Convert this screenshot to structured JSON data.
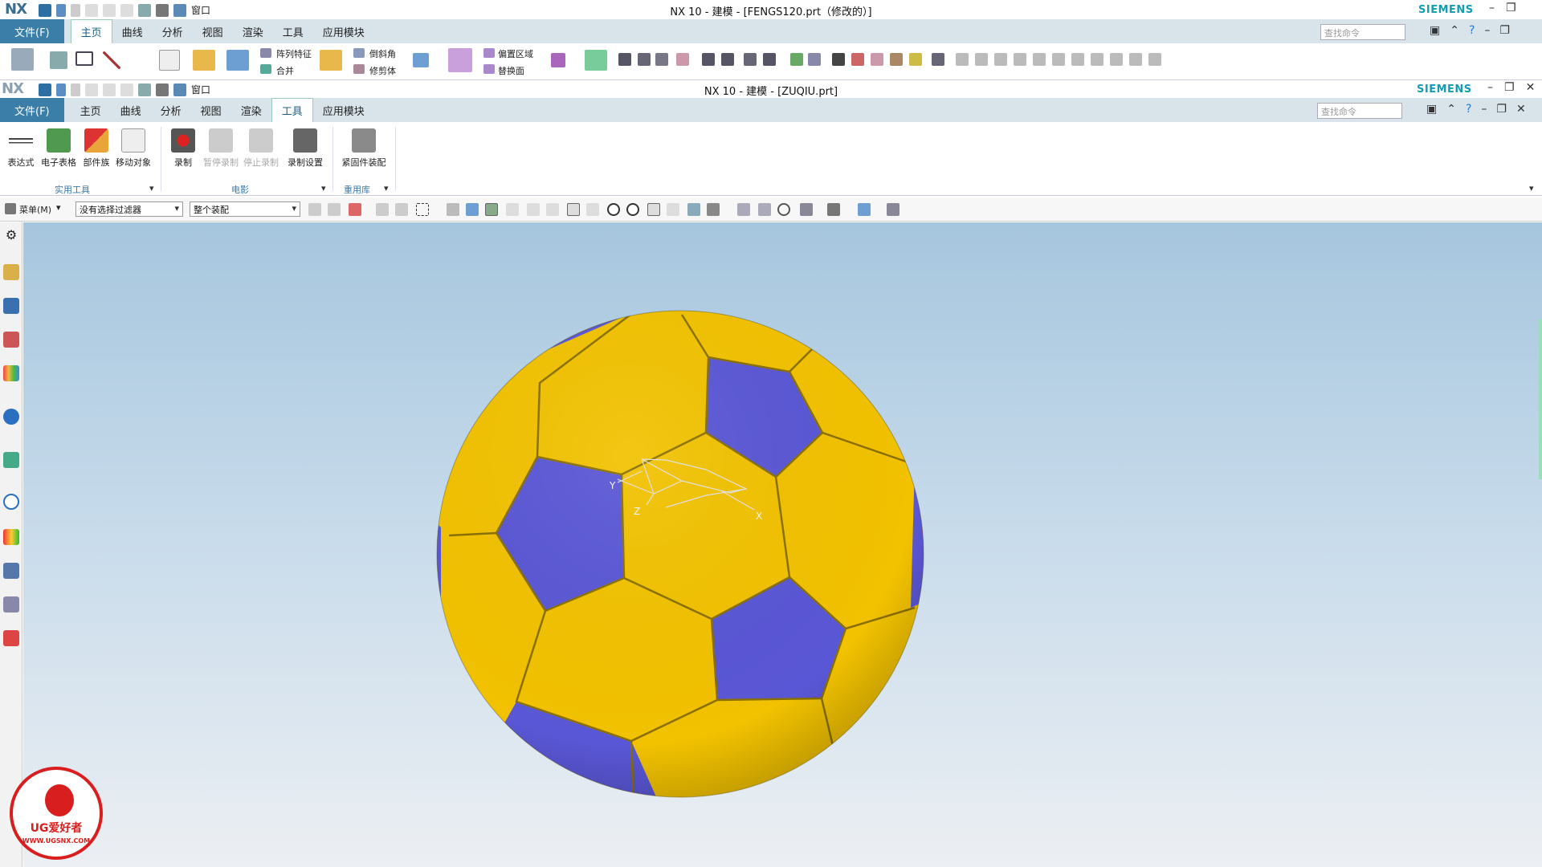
{
  "win1": {
    "logo": "NX",
    "title": "NX 10 - 建模 - [FENGS120.prt（修改的）]",
    "brand": "SIEMENS",
    "window_menu": "窗口",
    "file_menu": "文件(F)",
    "tabs": [
      "主页",
      "曲线",
      "分析",
      "视图",
      "渲染",
      "工具",
      "应用模块"
    ],
    "active_tab": "主页",
    "search_placeholder": "查找命令",
    "ribbon": {
      "array_feature": "阵列特征",
      "combine": "合并",
      "chamfer": "倒斜角",
      "trim_body": "修剪体",
      "offset_region": "偏置区域",
      "replace_face": "替换面"
    }
  },
  "win2": {
    "logo": "NX",
    "title": "NX 10 - 建模 - [ZUQIU.prt]",
    "brand": "SIEMENS",
    "window_menu": "窗口",
    "file_menu": "文件(F)",
    "tabs": [
      "主页",
      "曲线",
      "分析",
      "视图",
      "渲染",
      "工具",
      "应用模块"
    ],
    "active_tab": "工具",
    "search_placeholder": "查找命令",
    "ribbon": {
      "expression": "表达式",
      "spreadsheet": "电子表格",
      "part_family": "部件族",
      "move_object": "移动对象",
      "record": "录制",
      "pause_record": "暂停录制",
      "stop_record": "停止录制",
      "record_settings": "录制设置",
      "fastener_assembly": "紧固件装配",
      "group_utilities": "实用工具",
      "group_movie": "电影",
      "group_reuse": "重用库"
    },
    "selection_bar": {
      "menu_label": "菜单(M)",
      "filter_value": "没有选择过滤器",
      "scope_value": "整个装配"
    }
  },
  "viewport": {
    "triad": {
      "x": "X",
      "y": "Y",
      "z": "Z"
    },
    "colors": {
      "yellow": "#f2c200",
      "blue": "#5a57d6",
      "bg_top": "#a6c6de",
      "bg_bottom": "#eceff3"
    }
  },
  "watermark": {
    "brand": "UG爱好者",
    "url": "WWW.UGSNX.COM"
  }
}
